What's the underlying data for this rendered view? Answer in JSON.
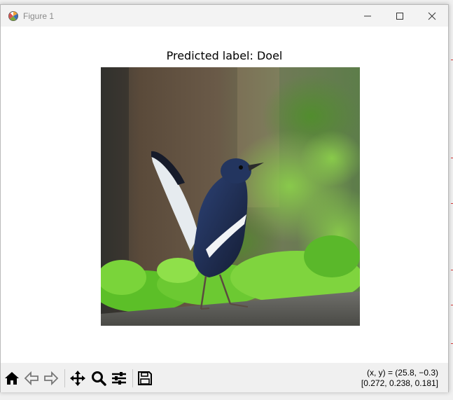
{
  "window": {
    "title": "Figure 1"
  },
  "figure": {
    "title": "Predicted label: Doel"
  },
  "toolbar": {
    "tools": [
      {
        "name": "home-icon"
      },
      {
        "name": "back-arrow-icon"
      },
      {
        "name": "forward-arrow-icon"
      },
      {
        "name": "pan-move-icon"
      },
      {
        "name": "zoom-magnifier-icon"
      },
      {
        "name": "configure-subplots-icon"
      },
      {
        "name": "save-floppy-icon"
      }
    ],
    "coords_line1": "(x, y) = (25.8, −0.3)",
    "coords_line2": "[0.272, 0.238, 0.181]"
  },
  "colors": {
    "toolbar_bg": "#f0f0f0",
    "titlebar_bg": "#f3f3f3",
    "bird_body": "#1f2f5c",
    "foliage": "#5fbf2a"
  }
}
